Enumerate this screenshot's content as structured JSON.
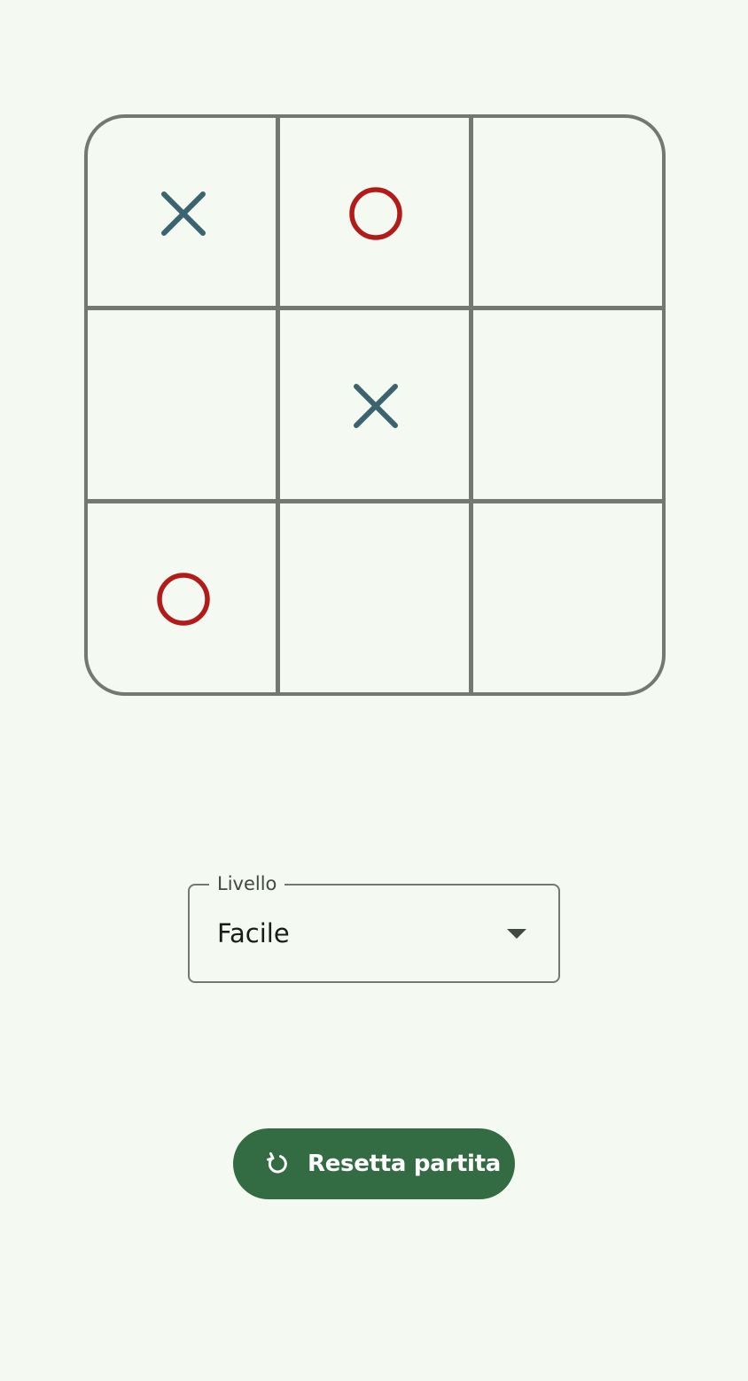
{
  "board": {
    "cells": [
      "X",
      "O",
      "",
      "",
      "X",
      "",
      "O",
      "",
      ""
    ]
  },
  "colors": {
    "x_mark": "#3a646f",
    "o_mark": "#b31b1b",
    "grid": "#737872",
    "background": "#f4f9f1",
    "button": "#336b42"
  },
  "level_select": {
    "label": "Livello",
    "value": "Facile"
  },
  "reset_button": {
    "label": "Resetta partita",
    "icon": "refresh-icon"
  }
}
